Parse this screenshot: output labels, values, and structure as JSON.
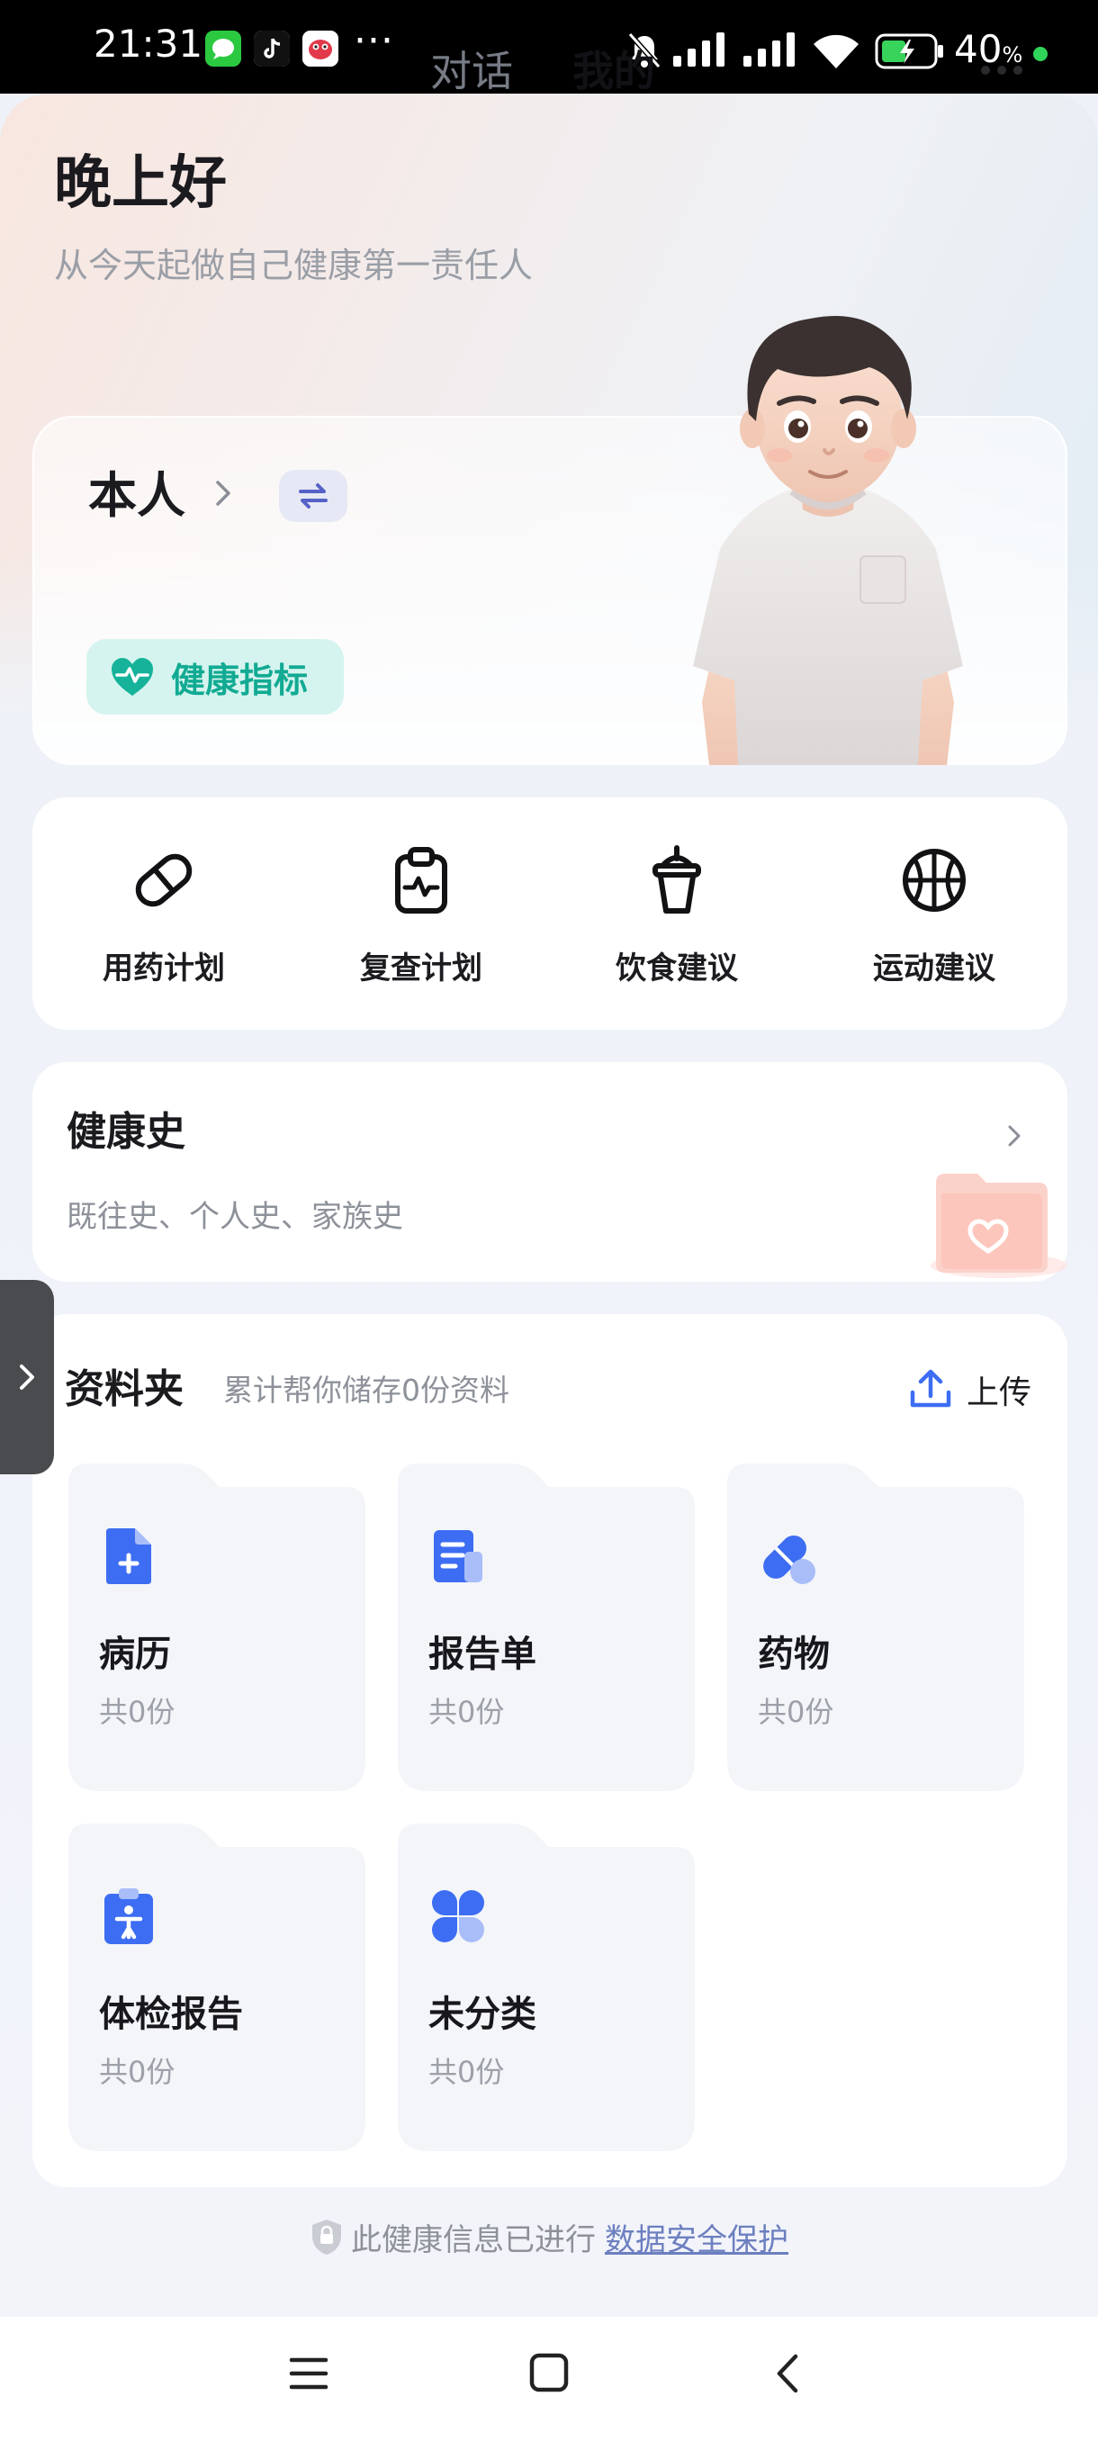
{
  "status_bar": {
    "time": "21:31",
    "notification_icons": [
      "messages-icon",
      "tiktok-icon",
      "app-icon"
    ],
    "overflow": "···",
    "battery_percent": "40",
    "battery_unit": "%",
    "system_icons": [
      "mute-icon",
      "signal-icon",
      "signal-icon",
      "wifi-icon",
      "battery-charging-icon"
    ]
  },
  "tabs": [
    {
      "label": "对话",
      "active": false
    },
    {
      "label": "我的",
      "active": true
    }
  ],
  "header": {
    "greeting": "晚上好",
    "slogan": "从今天起做自己健康第一责任人"
  },
  "profile": {
    "name": "本人",
    "health_button": "健康指标"
  },
  "tools": [
    {
      "label": "用药计划",
      "icon": "pill-icon"
    },
    {
      "label": "复查计划",
      "icon": "clipboard-pulse-icon"
    },
    {
      "label": "饮食建议",
      "icon": "drink-cup-icon"
    },
    {
      "label": "运动建议",
      "icon": "basketball-icon"
    }
  ],
  "health_history": {
    "title": "健康史",
    "subtitle": "既往史、个人史、家族史"
  },
  "folder": {
    "title": "资料夹",
    "subtitle": "累计帮你储存0份资料",
    "upload_label": "上传",
    "items": [
      {
        "name": "病历",
        "count": "共0份",
        "icon": "medical-record-icon"
      },
      {
        "name": "报告单",
        "count": "共0份",
        "icon": "report-icon"
      },
      {
        "name": "药物",
        "count": "共0份",
        "icon": "medicine-icon"
      },
      {
        "name": "体检报告",
        "count": "共0份",
        "icon": "checkup-report-icon"
      },
      {
        "name": "未分类",
        "count": "共0份",
        "icon": "uncategorized-icon"
      }
    ]
  },
  "footer": {
    "notice": "此健康信息已进行",
    "link": "数据安全保护"
  },
  "colors": {
    "accent": "#3d6df2",
    "health_chip_bg": "#d6f4ef",
    "health_chip_text": "#12aa93"
  }
}
